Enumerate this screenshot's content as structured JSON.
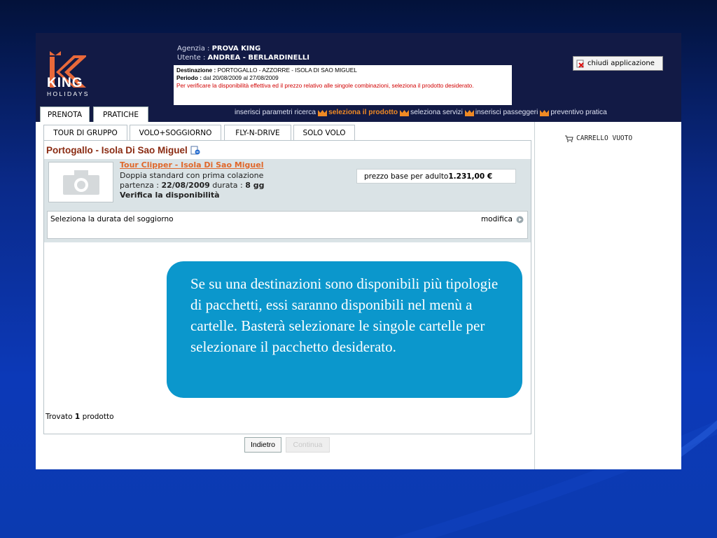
{
  "header": {
    "logo_text": "KING",
    "logo_sub": "HOLIDAYS",
    "agency_label": "Agenzia : ",
    "agency_value": "PROVA KING",
    "user_label": "Utente : ",
    "user_value": "ANDREA - BERLARDINELLI",
    "destination_label": "Destinazione : ",
    "destination_value": "PORTOGALLO - AZZORRE - ISOLA DI SAO MIGUEL",
    "period_label": "Periodo : ",
    "period_value": "dal 20/08/2009 al 27/08/2009",
    "notice": "Per verificare la disponibilità effettiva ed il prezzo relativo alle singole combinazioni, seleziona il prodotto desiderato.",
    "close_button": "chiudi applicazione"
  },
  "main_tabs": [
    {
      "label": "PRENOTA",
      "active": true
    },
    {
      "label": "PRATICHE",
      "active": false
    }
  ],
  "steps": [
    {
      "label": "inserisci parametri ricerca",
      "current": false
    },
    {
      "label": "seleziona il prodotto",
      "current": true
    },
    {
      "label": "seleziona servizi",
      "current": false
    },
    {
      "label": "inserisci passeggeri",
      "current": false
    },
    {
      "label": "preventivo pratica",
      "current": false
    }
  ],
  "content_tabs": [
    {
      "label": "TOUR DI GRUPPO",
      "active": true
    },
    {
      "label": "VOLO+SOGGIORNO",
      "active": false
    },
    {
      "label": "FLY-N-DRIVE",
      "active": false
    },
    {
      "label": "SOLO VOLO",
      "active": false
    }
  ],
  "product": {
    "destination_title": "Portogallo - Isola Di Sao Miguel",
    "tour_name": "Tour Clipper - Isola Di Sao Miguel",
    "room": "Doppia standard con prima colazione",
    "departure_label": "partenza : ",
    "departure_value": "22/08/2009",
    "duration_label": " durata : ",
    "duration_value": "8 gg",
    "availability": "Verifica la disponibilità",
    "price_label": "prezzo base per adulto ",
    "price_value": "1.231,00 €",
    "duration_select_label": "Seleziona la durata del soggiorno",
    "modify_label": "modifica"
  },
  "results": {
    "prefix": "Trovato ",
    "count": "1",
    "suffix": " prodotto"
  },
  "buttons": {
    "back": "Indietro",
    "continue": "Continua"
  },
  "sidebar": {
    "cart_label": "CARRELLO VUOTO"
  },
  "callout": {
    "text": "Se su una destinazioni sono disponibili più tipologie di pacchetti, essi saranno disponibili nel menù a cartelle. Basterà selezionare  le singole cartelle per selezionare il pacchetto desiderato."
  },
  "colors": {
    "header_bg": "#121a45",
    "logo_orange": "#e8693a",
    "step_current": "#f08a24",
    "title_red": "#8a2b12",
    "link_orange": "#e0682b",
    "callout_bg": "#0b97cc"
  }
}
